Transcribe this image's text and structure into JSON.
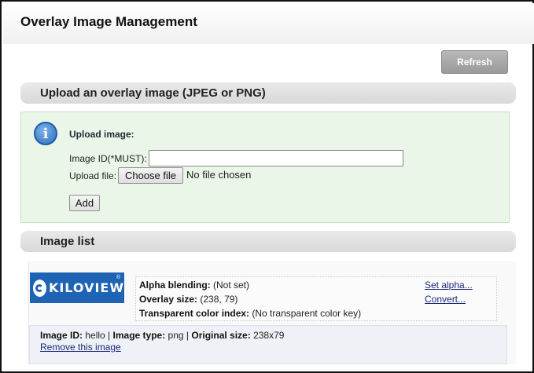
{
  "page": {
    "title": "Overlay Image Management"
  },
  "toolbar": {
    "refresh_label": "Refresh"
  },
  "upload_section": {
    "header": "Upload an overlay image (JPEG or PNG)",
    "heading": "Upload image:",
    "image_id_label": "Image ID(*MUST):",
    "image_id_value": "",
    "upload_file_label": "Upload file:",
    "choose_file_label": "Choose file",
    "no_file_text": "No file chosen",
    "add_label": "Add"
  },
  "image_list": {
    "header": "Image list",
    "items": [
      {
        "logo_text": "KILOVIEW",
        "logo_reg": "®",
        "alpha_label": "Alpha blending:",
        "alpha_value": "(Not set)",
        "overlay_size_label": "Overlay size:",
        "overlay_size_value": "(238, 79)",
        "transparent_label": "Transparent color index:",
        "transparent_value": "(No transparent color key)",
        "set_alpha_link": "Set alpha...",
        "convert_link": "Convert...",
        "image_id_label": "Image ID:",
        "image_id_value": "hello",
        "image_type_label": "Image type:",
        "image_type_value": "png",
        "original_size_label": "Original size:",
        "original_size_value": "238x79",
        "separator": " | ",
        "remove_link": "Remove this image"
      }
    ]
  },
  "colors": {
    "upload_panel_bg": "#eaf7e8",
    "link": "#1a2a7a",
    "logo_bg": "#1e63b4",
    "refresh_bg": "#a8a8a8"
  },
  "icons": {
    "info": "info-icon"
  }
}
